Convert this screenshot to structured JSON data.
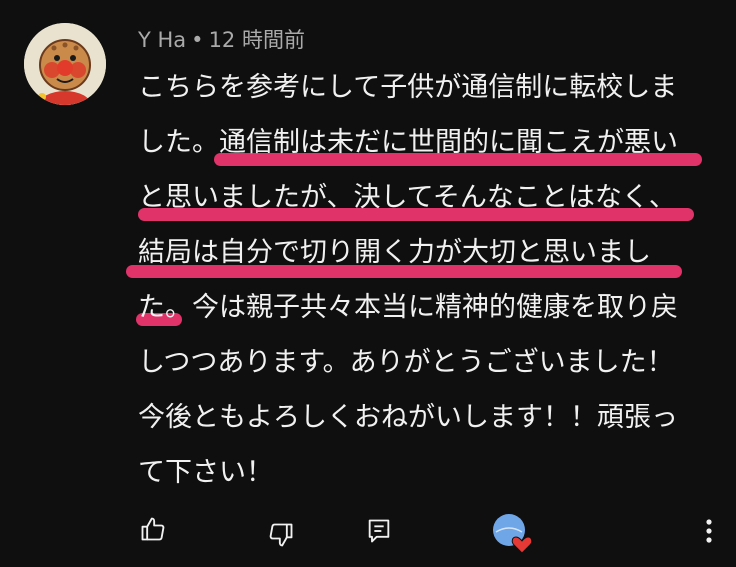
{
  "comment": {
    "author": "Y Ha",
    "separator": "•",
    "time": "12 時間前",
    "lines": [
      "こちらを参考にして子供が通信制に転校しま",
      "した。通信制は未だに世間的に聞こえが悪い",
      "と思いましたが、決してそんなことはなく、",
      "結局は自分で切り開く力が大切と思いまし",
      "た。今は親子共々本当に精神的健康を取り戻",
      "しつつあります。ありがとうございました！",
      "今後ともよろしくおねがいします！！頑張っ",
      "て下さい！"
    ]
  },
  "colors": {
    "background": "#0f0f0f",
    "text": "#f1f1f1",
    "meta": "#aaaaaa",
    "highlight": "#e0336a",
    "heart": "#e53935",
    "creator_avatar": "#6fa6e8"
  },
  "icons": {
    "like": "thumbs-up-icon",
    "dislike": "thumbs-down-icon",
    "reply": "reply-icon",
    "creator_heart": "creator-heart-icon",
    "more": "more-vertical-icon"
  }
}
